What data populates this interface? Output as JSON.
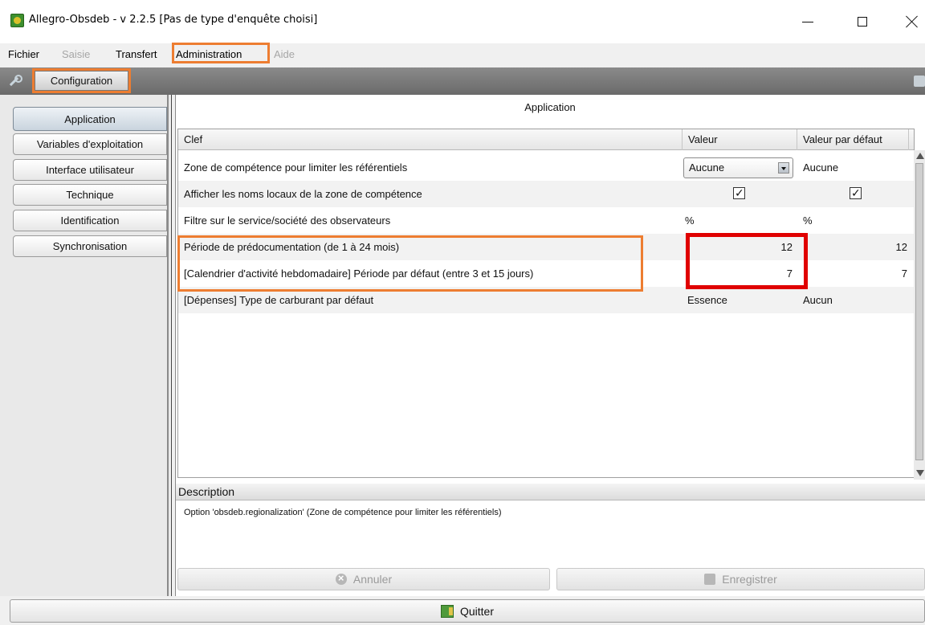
{
  "window": {
    "title": "Allegro-Obsdeb - v 2.2.5 [Pas de type d'enquête choisi]"
  },
  "menu": [
    {
      "label": "Fichier",
      "enabled": true
    },
    {
      "label": "Saisie",
      "enabled": false
    },
    {
      "label": "Transfert",
      "enabled": true
    },
    {
      "label": "Administration",
      "enabled": true
    },
    {
      "label": "Aide",
      "enabled": false
    }
  ],
  "toolbar": {
    "configuration_label": "Configuration"
  },
  "tabs": [
    {
      "label": "Application",
      "active": true
    },
    {
      "label": "Variables d'exploitation",
      "active": false
    },
    {
      "label": "Interface utilisateur",
      "active": false
    },
    {
      "label": "Technique",
      "active": false
    },
    {
      "label": "Identification",
      "active": false
    },
    {
      "label": "Synchronisation",
      "active": false
    }
  ],
  "section_title": "Application",
  "table": {
    "columns": [
      "Clef",
      "Valeur",
      "Valeur par défaut"
    ],
    "rows": [
      {
        "key": "Zone de compétence pour limiter les référentiels",
        "value": "Aucune",
        "default": "Aucune"
      },
      {
        "key": "Afficher les noms locaux de la zone de compétence",
        "value": "checked",
        "default": "checked"
      },
      {
        "key": "Filtre sur le service/société des observateurs",
        "value": "%",
        "default": "%"
      },
      {
        "key": "Période de prédocumentation (de 1 à 24 mois)",
        "value": "12",
        "default": "12"
      },
      {
        "key": "[Calendrier d'activité hebdomadaire] Période par défaut (entre 3 et 15 jours)",
        "value": "7",
        "default": "7"
      },
      {
        "key": "[Dépenses] Type de carburant par défaut",
        "value": "Essence",
        "default": "Aucun"
      }
    ]
  },
  "description": {
    "header": "Description",
    "text": "Option 'obsdeb.regionalization' (Zone de compétence pour limiter les référentiels)"
  },
  "buttons": {
    "cancel": "Annuler",
    "save": "Enregistrer",
    "quit": "Quitter"
  },
  "colors": {
    "highlight_orange": "#ed7d31",
    "highlight_red": "#e00000"
  }
}
